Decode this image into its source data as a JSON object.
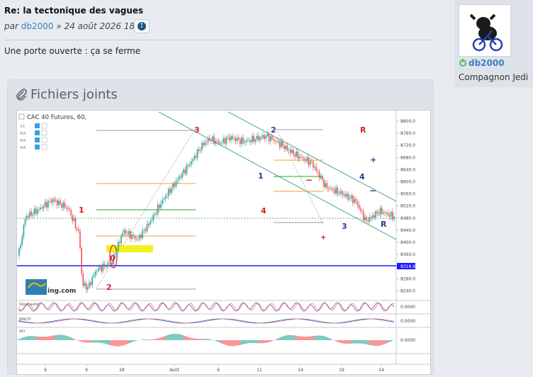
{
  "post": {
    "title": "Re: la tectonique des vagues",
    "by_label": "par",
    "author": "db2000",
    "date": "» 24 août 2026 18:21",
    "body": "Une porte ouverte : ça se ferme"
  },
  "attachments": {
    "heading": "Fichiers joints"
  },
  "profile": {
    "username": "db2000",
    "rank": "Compagnon Jedi"
  },
  "chart": {
    "title": "CAC 40 Futures, 60,",
    "indicator_labels": [
      "SS",
      "MA",
      "MA",
      "MA"
    ],
    "price_ticks": [
      "8800.0",
      "8760.0",
      "8720.0",
      "8680.0",
      "8640.0",
      "8600.0",
      "8560.0",
      "8520.0",
      "8480.0",
      "8440.0",
      "8400.0",
      "8360.0",
      "8320.0",
      "8280.0",
      "8240.0"
    ],
    "current_price": "8318.8",
    "x_ticks": [
      "6",
      "9",
      "28",
      "Août",
      "6",
      "11",
      "14",
      "19",
      "24"
    ],
    "osc_labels": [
      "0.0000",
      "0.0000",
      "0.0000"
    ],
    "sub_labels": [
      "Stochastic",
      "MACD",
      "AO"
    ],
    "logo_text": "ing.com",
    "wave_labels": {
      "w1_left": "1",
      "w3": "3",
      "w2_top": "2",
      "w1_mid": "1",
      "w4_mid": "4",
      "w0": "0",
      "w2_bottom": "2",
      "w3_right": "3",
      "w4_right": "4",
      "r_top": "R",
      "r_bottom": "R",
      "plus1": "+",
      "plus2": "+",
      "minus1": "−",
      "minus2": "−"
    },
    "colors": {
      "up": "#26a69a",
      "down": "#ef5350",
      "channel": "#2e9f7e",
      "support": "#1a1aff",
      "fib_orange": "#f0a030",
      "fib_green": "#2aa52a",
      "highlight": "#f2f21a",
      "wave_red": "#d42020",
      "wave_blue": "#2a3aa0"
    }
  }
}
